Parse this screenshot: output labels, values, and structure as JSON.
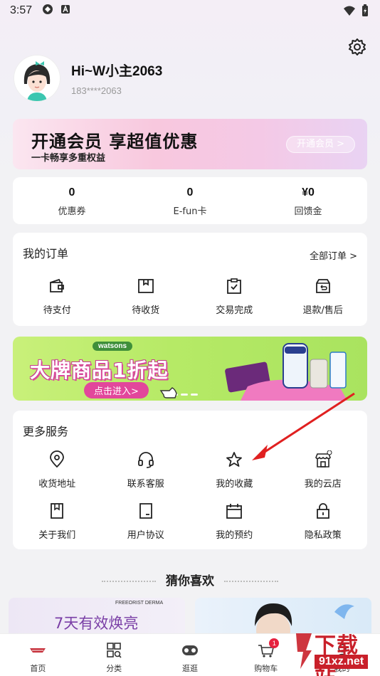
{
  "status_bar": {
    "time": "3:57"
  },
  "profile": {
    "name": "Hi~W小主2063",
    "phone": "183****2063"
  },
  "vip_banner": {
    "title": "开通会员 享超值优惠",
    "subtitle": "一卡畅享多重权益",
    "button": "开通会员 >"
  },
  "stats": [
    {
      "value": "0",
      "label": "优惠券"
    },
    {
      "value": "0",
      "label": "E-fun卡"
    },
    {
      "value": "¥0",
      "label": "回馈金"
    }
  ],
  "orders": {
    "title": "我的订单",
    "all_link": "全部订单 >",
    "items": [
      {
        "label": "待支付",
        "icon": "wallet-icon"
      },
      {
        "label": "待收货",
        "icon": "package-icon"
      },
      {
        "label": "交易完成",
        "icon": "clipboard-check-icon"
      },
      {
        "label": "退款/售后",
        "icon": "refund-box-icon"
      }
    ]
  },
  "promo": {
    "brand": "watsons",
    "headline": "大牌商品1折起",
    "cta": "点击进入>"
  },
  "services": {
    "title": "更多服务",
    "row1": [
      {
        "label": "收货地址",
        "icon": "location-pin-icon"
      },
      {
        "label": "联系客服",
        "icon": "headset-icon"
      },
      {
        "label": "我的收藏",
        "icon": "star-icon"
      },
      {
        "label": "我的云店",
        "icon": "store-icon"
      }
    ],
    "row2": [
      {
        "label": "关于我们",
        "icon": "bookmark-book-icon"
      },
      {
        "label": "用户协议",
        "icon": "document-icon"
      },
      {
        "label": "我的预约",
        "icon": "calendar-icon"
      },
      {
        "label": "隐私政策",
        "icon": "lock-icon"
      }
    ]
  },
  "guess_title": "猜你喜欢",
  "recommend": {
    "left_text": "7天有效焕亮",
    "left_brand": "FREEORIST DERMA"
  },
  "tabbar": [
    {
      "label": "首页",
      "icon": "home-logo-icon"
    },
    {
      "label": "分类",
      "icon": "category-grid-icon"
    },
    {
      "label": "逛逛",
      "icon": "browse-icon"
    },
    {
      "label": "购物车",
      "icon": "cart-icon",
      "badge": "1"
    },
    {
      "label": "我的",
      "icon": "profile-icon"
    }
  ],
  "watermark": {
    "text": "下载站",
    "url": "91xz.net"
  },
  "colors": {
    "accent_pink": "#e2479b",
    "promo_green": "#b6ea66",
    "badge_red": "#e6223f"
  }
}
